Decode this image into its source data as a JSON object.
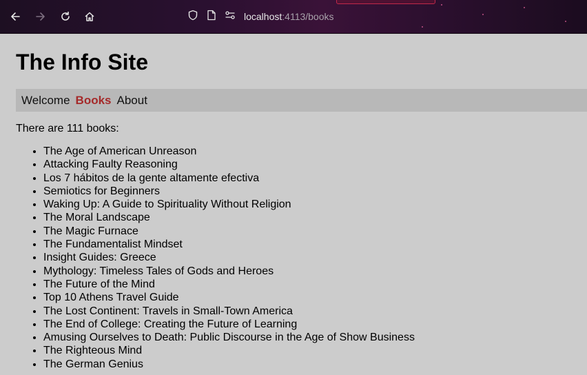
{
  "browser": {
    "url_host": "localhost",
    "url_rest": ":4113/books"
  },
  "site": {
    "title": "The Info Site"
  },
  "nav": {
    "items": [
      {
        "label": "Welcome",
        "active": false
      },
      {
        "label": "Books",
        "active": true
      },
      {
        "label": "About",
        "active": false
      }
    ]
  },
  "books": {
    "count_text": "There are 111 books:",
    "items": [
      "The Age of American Unreason",
      "Attacking Faulty Reasoning",
      "Los 7 hábitos de la gente altamente efectiva",
      "Semiotics for Beginners",
      "Waking Up: A Guide to Spirituality Without Religion",
      "The Moral Landscape",
      "The Magic Furnace",
      "The Fundamentalist Mindset",
      "Insight Guides: Greece",
      "Mythology: Timeless Tales of Gods and Heroes",
      "The Future of the Mind",
      "Top 10 Athens Travel Guide",
      "The Lost Continent: Travels in Small-Town America",
      "The End of College: Creating the Future of Learning",
      "Amusing Ourselves to Death: Public Discourse in the Age of Show Business",
      "The Righteous Mind",
      "The German Genius"
    ]
  },
  "colors": {
    "page_bg": "#cccccc",
    "nav_bg": "#b8b8b8",
    "active_link": "#a52a2a"
  },
  "icons": {
    "back": "back-arrow-icon",
    "forward": "forward-arrow-icon",
    "reload": "reload-icon",
    "home": "home-icon",
    "shield": "shield-icon",
    "page": "page-icon",
    "permissions": "permissions-icon"
  }
}
